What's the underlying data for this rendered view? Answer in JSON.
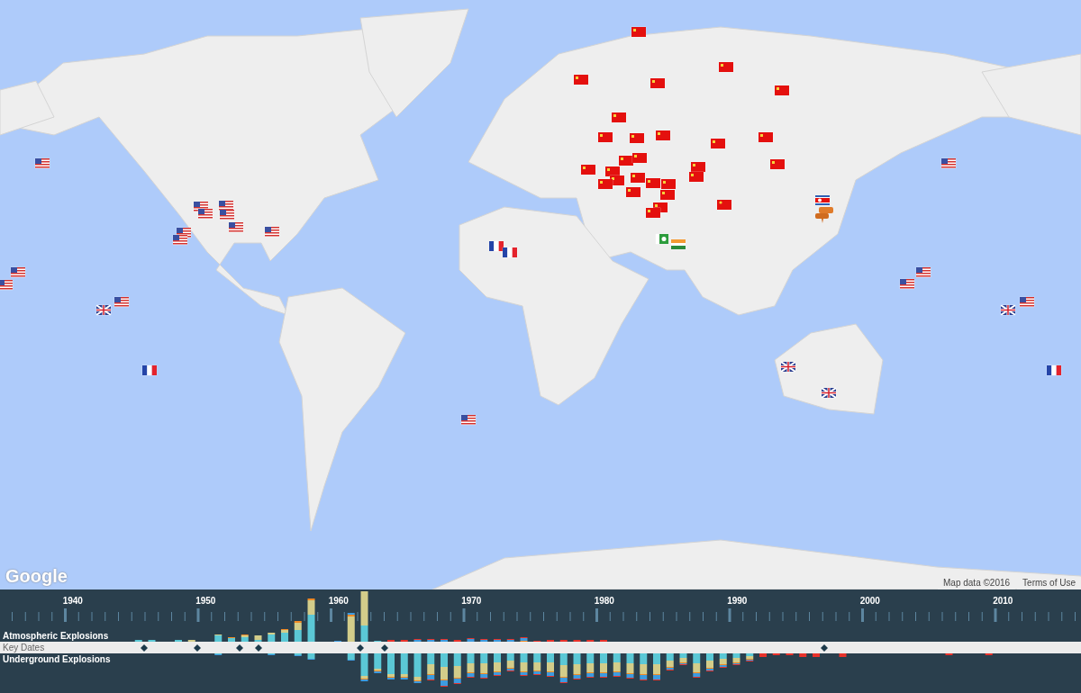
{
  "map": {
    "logo": "Google",
    "attribution": "Map data ©2016",
    "terms_link": "Terms of Use"
  },
  "timeline": {
    "years": [
      "1940",
      "1950",
      "1960",
      "1970",
      "1980",
      "1990",
      "2000",
      "2010"
    ],
    "rows": [
      {
        "kind": "atmospheric",
        "label": "Atmospheric Explosions"
      },
      {
        "kind": "key_dates",
        "label": "Key Dates"
      },
      {
        "kind": "underground",
        "label": "Underground Explosions"
      }
    ]
  }
}
